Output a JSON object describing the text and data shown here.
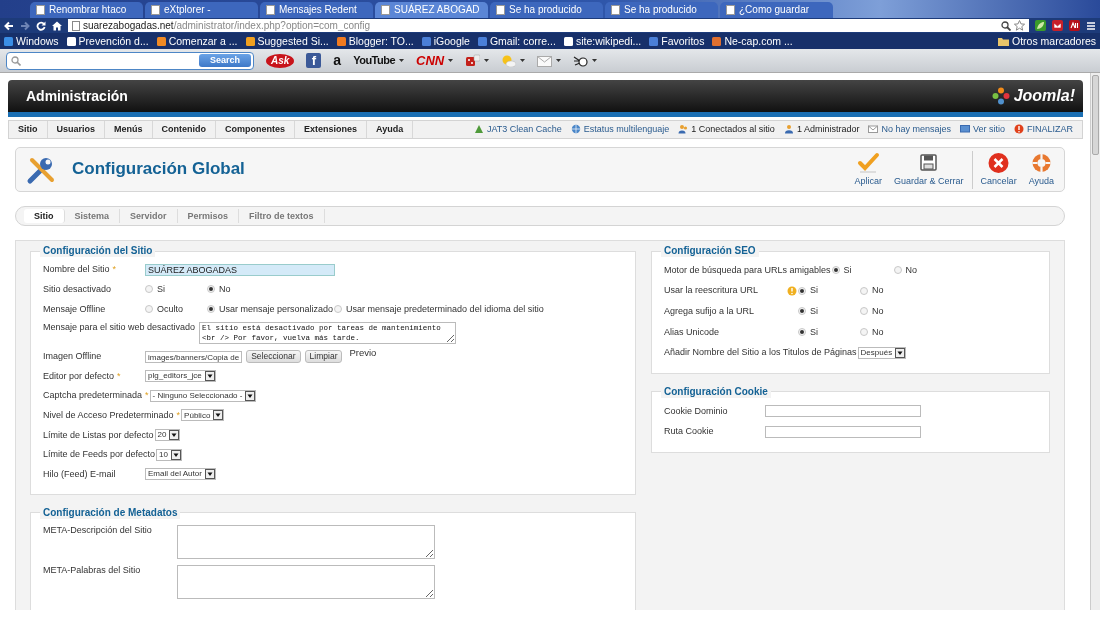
{
  "browser": {
    "tabs": [
      {
        "title": "Renombrar htaco",
        "selected": false
      },
      {
        "title": "eXtplorer -",
        "selected": false
      },
      {
        "title": "Mensajes Redent",
        "selected": false
      },
      {
        "title": "SUÁREZ ABOGAD",
        "selected": true
      },
      {
        "title": "Se ha producido",
        "selected": false
      },
      {
        "title": "Se ha producido",
        "selected": false
      },
      {
        "title": "¿Como guardar",
        "selected": false
      }
    ],
    "url": {
      "host": "suarezabogadas.net",
      "path": "/administrator/index.php?option=com_config"
    },
    "bookmarks": [
      "Windows",
      "Prevención d...",
      "Comenzar a ...",
      "Suggested Si...",
      "Blogger: TO...",
      "iGoogle",
      "Gmail: corre...",
      "site:wikipedi...",
      "Favoritos",
      "Ne-cap.com ..."
    ],
    "other_bookmarks": "Otros marcadores"
  },
  "ask_toolbar": {
    "search_button": "Search",
    "logo": "Ask",
    "sites": [
      {
        "kind": "facebook",
        "text": "f"
      },
      {
        "kind": "amazon",
        "text": "a"
      },
      {
        "kind": "youtube",
        "text": "YouTube"
      },
      {
        "kind": "cnn",
        "text": "CNN"
      }
    ]
  },
  "header": {
    "title": "Administración",
    "logo": "Joomla!"
  },
  "menu": [
    "Sitio",
    "Usuarios",
    "Menús",
    "Contenido",
    "Componentes",
    "Extensiones",
    "Ayuda"
  ],
  "status_links": [
    {
      "kind": "cache",
      "text": "JAT3 Clean Cache"
    },
    {
      "kind": "globe",
      "text": "Estatus multilenguaje"
    },
    {
      "kind": "users",
      "text": "1 Conectados al sitio"
    },
    {
      "kind": "user",
      "text": "1 Administrador"
    },
    {
      "kind": "mail",
      "text": "No hay mensajes"
    },
    {
      "kind": "site",
      "text": "Ver sitio"
    },
    {
      "kind": "logout",
      "text": "FINALIZAR"
    }
  ],
  "toolbar": {
    "title": "Configuración Global",
    "buttons": [
      {
        "kind": "apply",
        "label": "Aplicar"
      },
      {
        "kind": "save",
        "label": "Guardar & Cerrar"
      },
      {
        "kind": "cancel",
        "label": "Cancelar"
      },
      {
        "kind": "help",
        "label": "Ayuda"
      }
    ]
  },
  "tabs": [
    {
      "label": "Sitio",
      "selected": true
    },
    {
      "label": "Sistema",
      "selected": false
    },
    {
      "label": "Servidor",
      "selected": false
    },
    {
      "label": "Permisos",
      "selected": false
    },
    {
      "label": "Filtro de textos",
      "selected": false
    }
  ],
  "columns": [
    [
      {
        "title": "Configuración del Sitio",
        "fields": [
          {
            "kind": "text",
            "label": "Nombre del Sitio",
            "required_mark": "*",
            "value": "SUÁREZ ABOGADAS",
            "highlighted": true
          },
          {
            "kind": "radio",
            "label": "Sitio desactivado",
            "options": [
              {
                "label": "Si",
                "selected": false
              },
              {
                "label": "No",
                "selected": true
              }
            ]
          },
          {
            "kind": "radio",
            "label": "Mensaje Offline",
            "options": [
              {
                "label": "Oculto",
                "selected": false
              },
              {
                "label": "Usar mensaje personalizado",
                "selected": true
              },
              {
                "label": "Usar mensaje predeterminado del idioma del sitio",
                "selected": false
              }
            ]
          },
          {
            "kind": "textarea",
            "label": "Mensaje para el sitio web desactivado",
            "value": "El sitio está desactivado por tareas de mantenimiento\n<br /> Por favor, vuelva más tarde."
          },
          {
            "kind": "media",
            "label": "Imagen Offline",
            "value": "images/banners/Copia de",
            "buttons": [
              "Seleccionar",
              "Limpiar"
            ],
            "preview": "Previo"
          },
          {
            "kind": "select",
            "label": "Editor por defecto",
            "required_mark": "*",
            "value": "plg_editors_jce"
          },
          {
            "kind": "select",
            "label": "Captcha predeterminada",
            "required_mark": "*",
            "value": "- Ninguno Seleccionado -"
          },
          {
            "kind": "select",
            "label": "Nivel de Acceso Predeterminado",
            "required_mark": "*",
            "value": "Público"
          },
          {
            "kind": "select",
            "label": "Límite de Listas por defecto",
            "value": "20"
          },
          {
            "kind": "select",
            "label": "Límite de Feeds por defecto",
            "value": "10"
          },
          {
            "kind": "select",
            "label": "Hilo (Feed) E-mail",
            "value": "Email del Autor"
          }
        ]
      },
      {
        "title": "Configuración de Metadatos",
        "fields": [
          {
            "kind": "textarea",
            "label": "META-Descripción del Sitio"
          },
          {
            "kind": "textarea",
            "label": "META-Palabras del Sitio"
          }
        ]
      }
    ],
    [
      {
        "title": "Configuración SEO",
        "fields": [
          {
            "kind": "radio",
            "label": "Motor de búsqueda para URLs amigables",
            "options": [
              {
                "label": "Si",
                "selected": true
              },
              {
                "label": "No",
                "selected": false
              }
            ]
          },
          {
            "kind": "radio",
            "label": "Usar la reescritura URL",
            "warning": true,
            "options": [
              {
                "label": "Si",
                "selected": true
              },
              {
                "label": "No",
                "selected": false
              }
            ]
          },
          {
            "kind": "radio",
            "label": "Agrega sufijo a la URL",
            "options": [
              {
                "label": "Si",
                "selected": true
              },
              {
                "label": "No",
                "selected": false
              }
            ]
          },
          {
            "kind": "radio",
            "label": "Alias Unicode",
            "options": [
              {
                "label": "Si",
                "selected": true
              },
              {
                "label": "No",
                "selected": false
              }
            ]
          },
          {
            "kind": "select",
            "label": "Añadir Nombre del Sitio a los Titulos de Páginas",
            "value": "Después"
          }
        ]
      },
      {
        "title": "Configuración Cookie",
        "fields": [
          {
            "kind": "text",
            "label": "Cookie Dominio",
            "highlighted": false
          },
          {
            "kind": "text",
            "label": "Ruta Cookie",
            "highlighted": false
          }
        ]
      }
    ]
  ]
}
